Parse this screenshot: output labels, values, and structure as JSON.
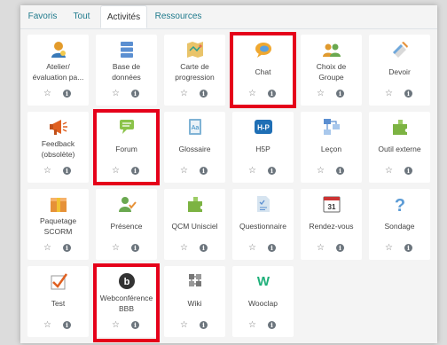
{
  "tabs": [
    {
      "label": "Favoris"
    },
    {
      "label": "Tout"
    },
    {
      "label": "Activités"
    },
    {
      "label": "Ressources"
    }
  ],
  "activities": [
    {
      "label": "Atelier/\névaluation pa...",
      "icon": "workshop-icon"
    },
    {
      "label": "Base de\ndonnées",
      "icon": "database-icon"
    },
    {
      "label": "Carte de\nprogression",
      "icon": "map-icon"
    },
    {
      "label": "Chat",
      "icon": "chat-icon"
    },
    {
      "label": "Choix de\nGroupe",
      "icon": "group-choice-icon"
    },
    {
      "label": "Devoir",
      "icon": "assignment-icon"
    },
    {
      "label": "Feedback\n(obsolète)",
      "icon": "megaphone-icon"
    },
    {
      "label": "Forum",
      "icon": "forum-icon"
    },
    {
      "label": "Glossaire",
      "icon": "glossary-icon"
    },
    {
      "label": "H5P",
      "icon": "h5p-icon",
      "icon_text": "H-P"
    },
    {
      "label": "Leçon",
      "icon": "lesson-icon"
    },
    {
      "label": "Outil externe",
      "icon": "puzzle-icon"
    },
    {
      "label": "Paquetage\nSCORM",
      "icon": "package-icon"
    },
    {
      "label": "Présence",
      "icon": "attendance-icon"
    },
    {
      "label": "QCM Unisciel",
      "icon": "puzzle-icon"
    },
    {
      "label": "Questionnaire",
      "icon": "questionnaire-icon"
    },
    {
      "label": "Rendez-vous",
      "icon": "calendar-icon",
      "icon_text": "31"
    },
    {
      "label": "Sondage",
      "icon": "question-icon",
      "icon_text": "?"
    },
    {
      "label": "Test",
      "icon": "checkbox-icon"
    },
    {
      "label": "Webconférence\nBBB",
      "icon": "bbb-icon",
      "icon_text": "b"
    },
    {
      "label": "Wiki",
      "icon": "wiki-icon"
    },
    {
      "label": "Wooclap",
      "icon": "wooclap-icon",
      "icon_text": "W"
    }
  ],
  "star_glyph": "☆",
  "info_glyph": "i",
  "colors": {
    "highlight": "#e5001a",
    "link": "#1f7a8c"
  }
}
